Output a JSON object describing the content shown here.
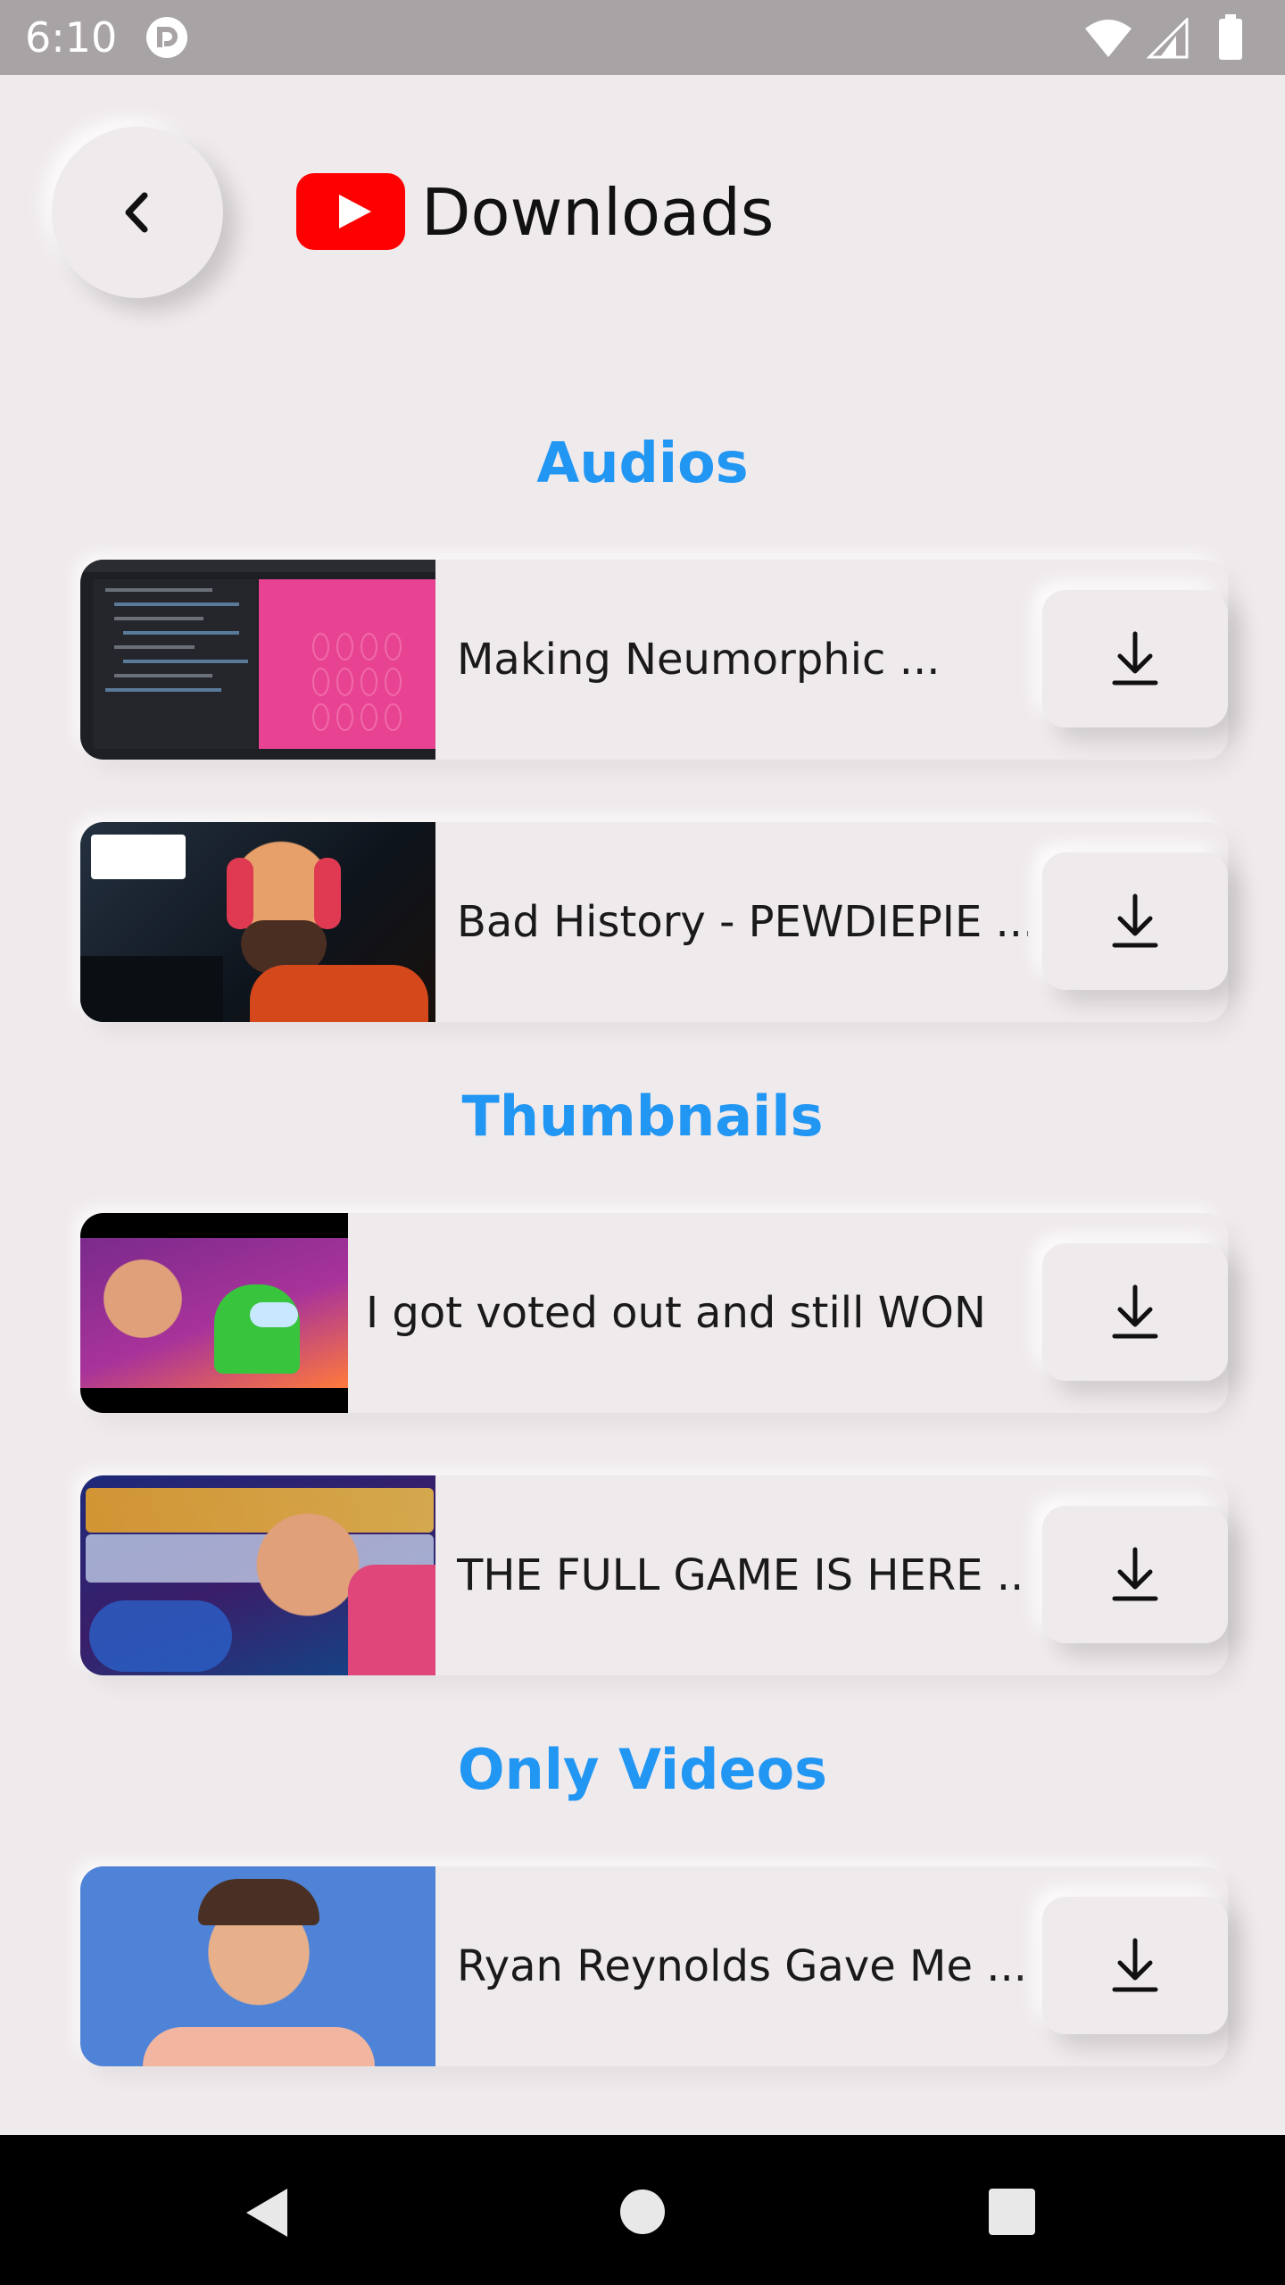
{
  "status_bar": {
    "time": "6:10",
    "icons": [
      "app-notification-icon",
      "wifi-icon",
      "cell-signal-icon",
      "battery-icon"
    ]
  },
  "header": {
    "title": "Downloads",
    "back_icon": "chevron-left-icon",
    "logo": "youtube-logo"
  },
  "colors": {
    "background": "#efeaec",
    "accent": "#2196f3",
    "youtube_red": "#ff0000",
    "text": "#111111"
  },
  "sections": [
    {
      "heading": "Audios",
      "items": [
        {
          "title": "Making Neumorphic ...",
          "action_icon": "download-icon"
        },
        {
          "title": "Bad History - PEWDIEPIE ...",
          "action_icon": "download-icon"
        }
      ]
    },
    {
      "heading": "Thumbnails",
      "items": [
        {
          "title": "I got voted out and still WON",
          "action_icon": "download-icon"
        },
        {
          "title": "THE FULL GAME IS HERE ...",
          "action_icon": "download-icon"
        }
      ]
    },
    {
      "heading": "Only Videos",
      "items": [
        {
          "title": "Ryan Reynolds Gave Me ...",
          "action_icon": "download-icon"
        }
      ]
    }
  ],
  "nav_bar": {
    "icons": [
      "nav-back-icon",
      "nav-home-icon",
      "nav-recents-icon"
    ]
  }
}
